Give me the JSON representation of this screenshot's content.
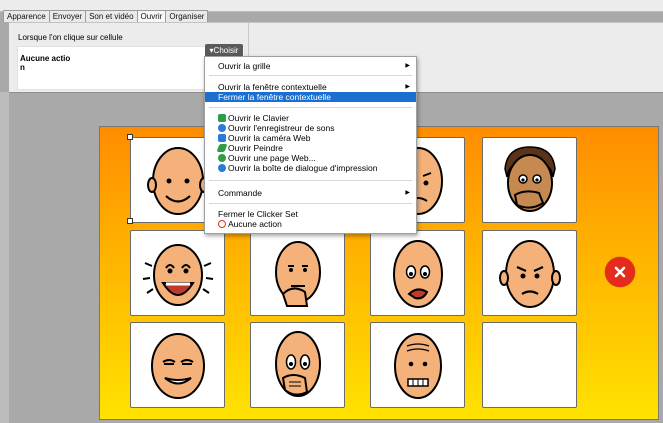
{
  "tabs": [
    {
      "label": "Apparence"
    },
    {
      "label": "Envoyer"
    },
    {
      "label": "Son et vidéo"
    },
    {
      "label": "Ouvrir"
    },
    {
      "label": "Organiser"
    }
  ],
  "panel": {
    "label": "Lorsque l'on clique sur cellule",
    "action_line1": "Aucune actio",
    "action_line2": "n",
    "choose_button": "▾Choisir"
  },
  "menu": {
    "items": [
      {
        "label": "Ouvrir la grille",
        "submenu": true
      },
      {
        "label": "Ouvrir la fenêtre contextuelle",
        "submenu": true
      },
      {
        "label": "Fermer la fenêtre contextuelle",
        "highlighted": true
      },
      {
        "label": "Ouvrir le Clavier",
        "icon": "keyboard-icon"
      },
      {
        "label": "Ouvrir l'enregistreur de sons",
        "icon": "microphone-icon"
      },
      {
        "label": "Ouvrir la caméra Web",
        "icon": "camera-icon"
      },
      {
        "label": "Ouvrir Peindre",
        "icon": "pencil-icon"
      },
      {
        "label": "Ouvrir une page Web...",
        "icon": "web-icon"
      },
      {
        "label": "Ouvrir la boîte de dialogue d'impression",
        "icon": "printer-icon"
      },
      {
        "label": "Commande",
        "submenu": true
      },
      {
        "label": "Fermer le Clicker Set"
      },
      {
        "label": "Aucune action",
        "icon": "no-action-icon"
      }
    ],
    "submenu_arrow": "▶"
  },
  "board": {
    "cells": [
      {
        "face": "smiling-face-icon"
      },
      {
        "face": "blank"
      },
      {
        "face": "worried-face-icon"
      },
      {
        "face": "covering-mouth-face-icon"
      },
      {
        "face": "laughing-face-icon"
      },
      {
        "face": "thinking-face-icon"
      },
      {
        "face": "upset-face-icon"
      },
      {
        "face": "angry-face-icon"
      },
      {
        "face": "sly-face-icon"
      },
      {
        "face": "shocked-face-icon"
      },
      {
        "face": "nervous-face-icon"
      },
      {
        "face": "blank"
      }
    ]
  },
  "colors": {
    "highlight": "#1b6fd1",
    "close": "#e42b1e",
    "skin": "#f4b27a"
  }
}
